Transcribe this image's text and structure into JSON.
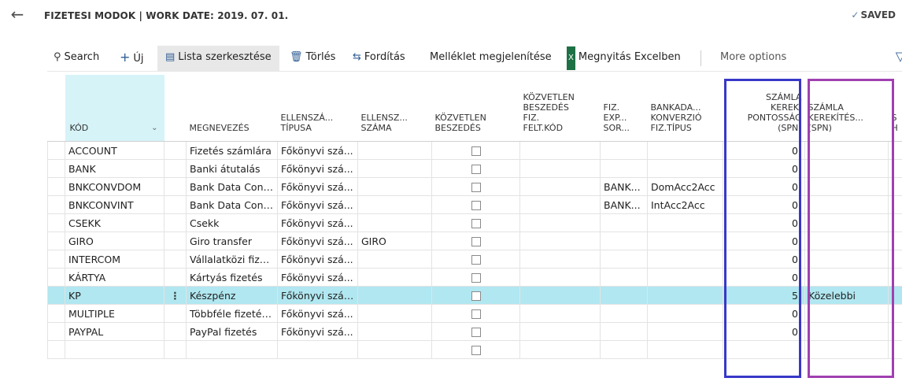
{
  "header": {
    "back_icon": "arrow-left-icon",
    "title": "FIZETESI MODOK | WORK DATE: 2019. 07. 01.",
    "saved": "SAVED"
  },
  "toolbar": {
    "search": "Search",
    "new": "Új",
    "edit_list": "Lista szerkesztése",
    "delete": "Törlés",
    "translate": "Fordítás",
    "show_attachments": "Melléklet megjelenítése",
    "open_excel": "Megnyitás Excelben",
    "more_options": "More options"
  },
  "columns": {
    "kod": "KÓD",
    "megnevezes": "MEGNEVEZÉS",
    "ellenszamla_tipusa": [
      "ELLENSZÁ...",
      "TÍPUSA"
    ],
    "ellenszamla_szama": [
      "ELLENSZ...",
      "SZÁMA"
    ],
    "kozvetlen_beszedes": [
      "KÖZVETLEN",
      "BESZEDÉS"
    ],
    "kozvetlen_fiz_felt": [
      "KÖZVETLEN",
      "BESZEDÉS",
      "FIZ.",
      "FELT.KÓD"
    ],
    "fiz_exp": [
      "FIZ.",
      "EXP...",
      "SOR..."
    ],
    "bankadat": [
      "BANKADA...",
      "KONVERZIÓ",
      "FIZ.TÍPUS"
    ],
    "szamla_kerek_pontossag": [
      "SZÁMLA",
      "KEREK.",
      "PONTOSSÁG",
      "(SPN)"
    ],
    "szamla_kerekites": [
      "SZÁMLA",
      "KEREKÍTÉS...",
      "(SPN)"
    ],
    "extra": [
      "S",
      "H"
    ]
  },
  "rows": [
    {
      "kod": "ACCOUNT",
      "megnevezes": "Fizetés számlára",
      "tipus": "Főkönyvi szá...",
      "szama": "",
      "exp": "",
      "konv": "",
      "pontossag": "0",
      "kerekites": ""
    },
    {
      "kod": "BANK",
      "megnevezes": "Banki átutalás",
      "tipus": "Főkönyvi szá...",
      "szama": "",
      "exp": "",
      "konv": "",
      "pontossag": "0",
      "kerekites": ""
    },
    {
      "kod": "BNKCONVDOM",
      "megnevezes": "Bank Data Conv...",
      "tipus": "Főkönyvi szá...",
      "szama": "",
      "exp": "BANK...",
      "konv": "DomAcc2Acc",
      "pontossag": "0",
      "kerekites": ""
    },
    {
      "kod": "BNKCONVINT",
      "megnevezes": "Bank Data Conv...",
      "tipus": "Főkönyvi szá...",
      "szama": "",
      "exp": "BANK...",
      "konv": "IntAcc2Acc",
      "pontossag": "0",
      "kerekites": ""
    },
    {
      "kod": "CSEKK",
      "megnevezes": "Csekk",
      "tipus": "Főkönyvi szá...",
      "szama": "",
      "exp": "",
      "konv": "",
      "pontossag": "0",
      "kerekites": ""
    },
    {
      "kod": "GIRO",
      "megnevezes": "Giro transfer",
      "tipus": "Főkönyvi szá...",
      "szama": "GIRO",
      "exp": "",
      "konv": "",
      "pontossag": "0",
      "kerekites": ""
    },
    {
      "kod": "INTERCOM",
      "megnevezes": "Vállalatközi fize...",
      "tipus": "Főkönyvi szá...",
      "szama": "",
      "exp": "",
      "konv": "",
      "pontossag": "0",
      "kerekites": ""
    },
    {
      "kod": "KÁRTYA",
      "megnevezes": "Kártyás fizetés",
      "tipus": "Főkönyvi szá...",
      "szama": "",
      "exp": "",
      "konv": "",
      "pontossag": "0",
      "kerekites": ""
    },
    {
      "kod": "KP",
      "megnevezes": "Készpénz",
      "tipus": "Főkönyvi száml",
      "szama": "",
      "exp": "",
      "konv": "",
      "pontossag": "5",
      "kerekites": "Közelebbi"
    },
    {
      "kod": "MULTIPLE",
      "megnevezes": "Többféle fizetés...",
      "tipus": "Főkönyvi szá...",
      "szama": "",
      "exp": "",
      "konv": "",
      "pontossag": "0",
      "kerekites": ""
    },
    {
      "kod": "PAYPAL",
      "megnevezes": "PayPal fizetés",
      "tipus": "Főkönyvi szá...",
      "szama": "",
      "exp": "",
      "konv": "",
      "pontossag": "0",
      "kerekites": ""
    },
    {
      "kod": "",
      "megnevezes": "",
      "tipus": "",
      "szama": "",
      "exp": "",
      "konv": "",
      "pontossag": "",
      "kerekites": ""
    }
  ],
  "colors": {
    "selected_row": "#b1e7f0",
    "highlight_blue": "#3838c8",
    "highlight_purple": "#a040b0",
    "accent": "#2f5d93"
  }
}
